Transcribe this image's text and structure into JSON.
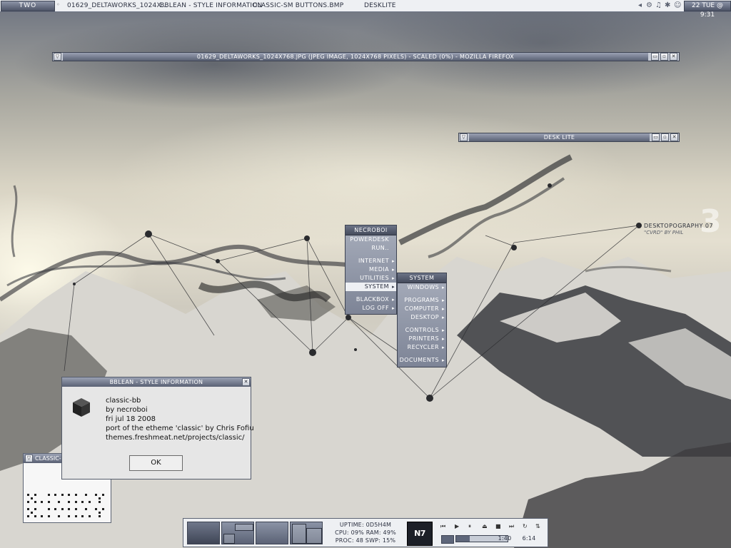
{
  "toolbar": {
    "workspace": "TWO",
    "tasks": [
      "01629_DELTAWORKS_1024X...",
      "BBLEAN - STYLE INFORMATION",
      "CLASSIC-SM BUTTONS.BMP",
      "DESKLITE"
    ],
    "clock": "22 TUE @ 9:31"
  },
  "windows": {
    "firefox_title": "01629_DELTAWORKS_1024X768.JPG (JPEG IMAGE, 1024X768 PIXELS) - SCALED (0%) - MOZILLA FIREFOX",
    "desklite_title": "DESK LITE"
  },
  "menu_root": {
    "title": "NECROBOI",
    "items": [
      "POWERDESK",
      "RUN..",
      "INTERNET",
      "MEDIA",
      "UTILITIES",
      "SYSTEM",
      "BLACKBOX",
      "LOG OFF"
    ]
  },
  "menu_system": {
    "title": "SYSTEM",
    "items": [
      "WINDOWS",
      "PROGRAMS",
      "COMPUTER",
      "DESKTOP",
      "CONTROLS",
      "PRINTERS",
      "RECYCLER",
      "DOCUMENTS"
    ]
  },
  "dialog": {
    "title": "BBLEAN - STYLE INFORMATION",
    "lines": [
      "classic-bb",
      "by necroboi",
      "fri jul 18 2008",
      "port of the etheme 'classic' by Chris Fofiu",
      "themes.freshmeat.net/projects/classic/"
    ],
    "ok": "OK"
  },
  "preview": {
    "title": "CLASSIC-SM BUTTONS.BMP"
  },
  "wallpaper": {
    "title": "DESKTOPOGRAPHY 07",
    "subtitle": "\"CVRD\" BY PHIL",
    "big": "3"
  },
  "slit": {
    "uptime": "UPTIME: 0D5H4M",
    "cpu_ram": "CPU: 09%  RAM: 49%",
    "proc_swp": "PROC: 48  SWP: 15%",
    "badge": "N7",
    "elapsed": "1:40",
    "total": "6:14",
    "progress": 0.27
  }
}
